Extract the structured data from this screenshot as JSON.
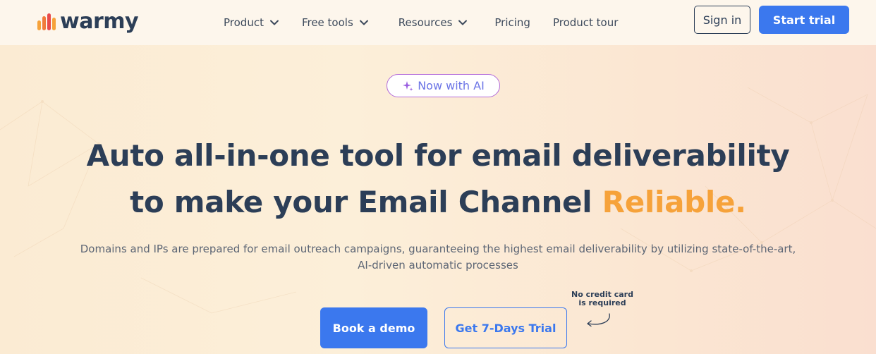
{
  "brand": {
    "name": "warmy",
    "colors": {
      "bar1": "#f6a23a",
      "bar2": "#f07a3a",
      "bar3": "#e84a4a",
      "bar4": "#f6a23a"
    }
  },
  "nav": {
    "items": [
      {
        "label": "Product",
        "has_dropdown": true
      },
      {
        "label": "Free tools",
        "has_dropdown": true
      },
      {
        "label": "Resources",
        "has_dropdown": true
      },
      {
        "label": "Pricing",
        "has_dropdown": false
      },
      {
        "label": "Product tour",
        "has_dropdown": false
      }
    ],
    "sign_in_label": "Sign in",
    "start_trial_label": "Start trial"
  },
  "hero": {
    "badge": "Now with AI",
    "headline_line1": "Auto all-in-one tool for email deliverability",
    "headline_line2_prefix": "to make your Email Channel ",
    "headline_accent": "Reliable.",
    "subtext_line1": "Domains and IPs are prepared for email outreach campaigns, guaranteeing the highest email deliverability by utilizing state-of-the-art,",
    "subtext_line2": "AI-driven automatic processes",
    "demo_label": "Book a demo",
    "trial_label": "Get 7-Days Trial",
    "note_line1": "No credit card",
    "note_line2": "is required"
  },
  "icons": {
    "dropdown": "chevron-down-icon",
    "badge": "sparkle-icon",
    "note": "curved-arrow-icon"
  },
  "theme": {
    "primary": "#3b78ee",
    "text_dark": "#2c3e57",
    "accent_orange": "#f6a23a",
    "badge_border": "#b36ad9"
  }
}
